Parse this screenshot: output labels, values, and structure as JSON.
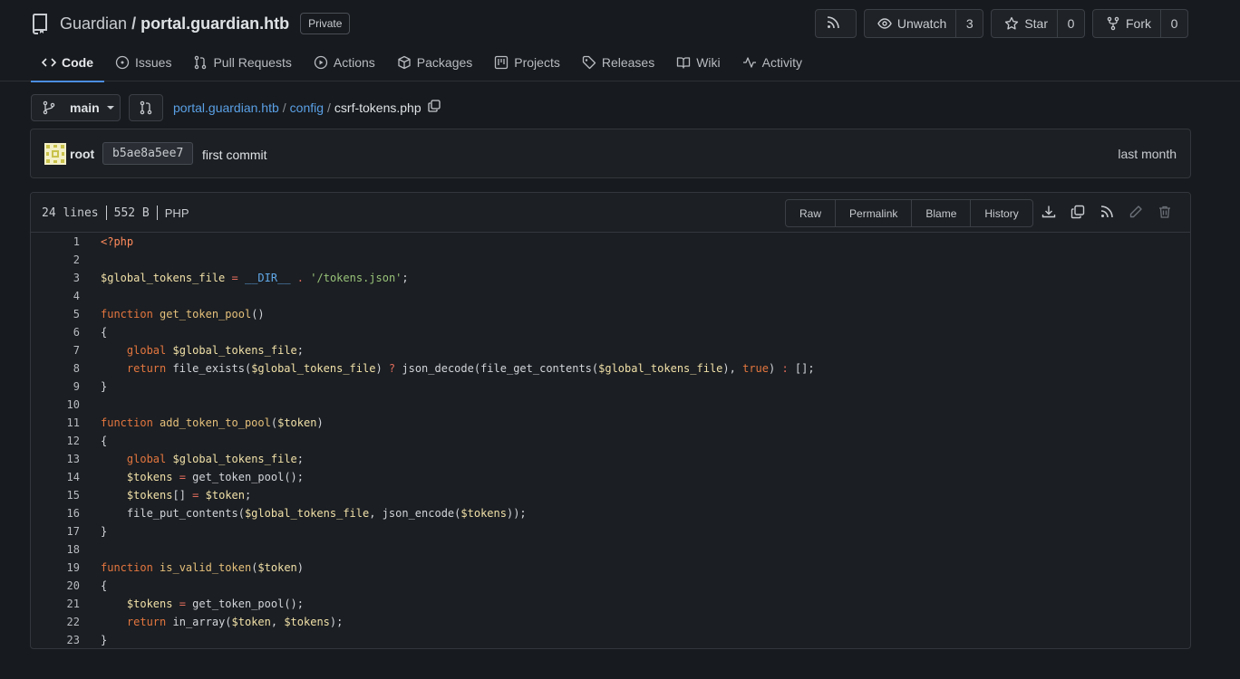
{
  "repo": {
    "owner": "Guardian",
    "separator": "/",
    "name": "portal.guardian.htb",
    "visibility": "Private"
  },
  "header_buttons": {
    "unwatch_label": "Unwatch",
    "unwatch_count": "3",
    "star_label": "Star",
    "star_count": "0",
    "fork_label": "Fork",
    "fork_count": "0"
  },
  "tabs": [
    {
      "label": "Code",
      "icon": "code-icon",
      "active": true
    },
    {
      "label": "Issues",
      "icon": "issue-icon"
    },
    {
      "label": "Pull Requests",
      "icon": "pull-request-icon"
    },
    {
      "label": "Actions",
      "icon": "play-icon"
    },
    {
      "label": "Packages",
      "icon": "package-icon"
    },
    {
      "label": "Projects",
      "icon": "project-icon"
    },
    {
      "label": "Releases",
      "icon": "tag-icon"
    },
    {
      "label": "Wiki",
      "icon": "book-icon"
    },
    {
      "label": "Activity",
      "icon": "pulse-icon"
    }
  ],
  "branch": "main",
  "breadcrumb": {
    "root": "portal.guardian.htb",
    "sep1": "/",
    "dir": "config",
    "sep2": "/",
    "file": "csrf-tokens.php"
  },
  "commit": {
    "author": "root",
    "sha": "b5ae8a5ee7",
    "message": "first commit",
    "time": "last month"
  },
  "file": {
    "lines": "24 lines",
    "size": "552 B",
    "language": "PHP",
    "actions": [
      "Raw",
      "Permalink",
      "Blame",
      "History"
    ],
    "icons": [
      "download-icon",
      "copy-icon",
      "rss-icon",
      "edit-icon",
      "delete-icon"
    ]
  },
  "colors": {
    "background": "#171a1e",
    "accent": "#4c8ee0",
    "link": "#5aa0e6"
  },
  "code_lines": [
    [
      [
        "t",
        "<?php"
      ]
    ],
    [],
    [
      [
        "v",
        "$global_tokens_file"
      ],
      [
        "p",
        " "
      ],
      [
        "op",
        "="
      ],
      [
        "p",
        " "
      ],
      [
        "c",
        "__DIR__"
      ],
      [
        "p",
        " "
      ],
      [
        "op",
        "."
      ],
      [
        "p",
        " "
      ],
      [
        "s",
        "'/tokens.json'"
      ],
      [
        "p",
        ";"
      ]
    ],
    [],
    [
      [
        "kw",
        "function"
      ],
      [
        "p",
        " "
      ],
      [
        "f",
        "get_token_pool"
      ],
      [
        "p",
        "()"
      ]
    ],
    [
      [
        "p",
        "{"
      ]
    ],
    [
      [
        "p",
        "    "
      ],
      [
        "kw",
        "global"
      ],
      [
        "p",
        " "
      ],
      [
        "v",
        "$global_tokens_file"
      ],
      [
        "p",
        ";"
      ]
    ],
    [
      [
        "p",
        "    "
      ],
      [
        "kw",
        "return"
      ],
      [
        "p",
        " file_exists("
      ],
      [
        "v",
        "$global_tokens_file"
      ],
      [
        "p",
        ") "
      ],
      [
        "op",
        "?"
      ],
      [
        "p",
        " json_decode(file_get_contents("
      ],
      [
        "v",
        "$global_tokens_file"
      ],
      [
        "p",
        "), "
      ],
      [
        "kw",
        "true"
      ],
      [
        "p",
        ") "
      ],
      [
        "op",
        ":"
      ],
      [
        "p",
        " [];"
      ]
    ],
    [
      [
        "p",
        "}"
      ]
    ],
    [],
    [
      [
        "kw",
        "function"
      ],
      [
        "p",
        " "
      ],
      [
        "f",
        "add_token_to_pool"
      ],
      [
        "p",
        "("
      ],
      [
        "v",
        "$token"
      ],
      [
        "p",
        ")"
      ]
    ],
    [
      [
        "p",
        "{"
      ]
    ],
    [
      [
        "p",
        "    "
      ],
      [
        "kw",
        "global"
      ],
      [
        "p",
        " "
      ],
      [
        "v",
        "$global_tokens_file"
      ],
      [
        "p",
        ";"
      ]
    ],
    [
      [
        "p",
        "    "
      ],
      [
        "v",
        "$tokens"
      ],
      [
        "p",
        " "
      ],
      [
        "op",
        "="
      ],
      [
        "p",
        " get_token_pool();"
      ]
    ],
    [
      [
        "p",
        "    "
      ],
      [
        "v",
        "$tokens"
      ],
      [
        "p",
        "[] "
      ],
      [
        "op",
        "="
      ],
      [
        "p",
        " "
      ],
      [
        "v",
        "$token"
      ],
      [
        "p",
        ";"
      ]
    ],
    [
      [
        "p",
        "    file_put_contents("
      ],
      [
        "v",
        "$global_tokens_file"
      ],
      [
        "p",
        ", json_encode("
      ],
      [
        "v",
        "$tokens"
      ],
      [
        "p",
        "));"
      ]
    ],
    [
      [
        "p",
        "}"
      ]
    ],
    [],
    [
      [
        "kw",
        "function"
      ],
      [
        "p",
        " "
      ],
      [
        "f",
        "is_valid_token"
      ],
      [
        "p",
        "("
      ],
      [
        "v",
        "$token"
      ],
      [
        "p",
        ")"
      ]
    ],
    [
      [
        "p",
        "{"
      ]
    ],
    [
      [
        "p",
        "    "
      ],
      [
        "v",
        "$tokens"
      ],
      [
        "p",
        " "
      ],
      [
        "op",
        "="
      ],
      [
        "p",
        " get_token_pool();"
      ]
    ],
    [
      [
        "p",
        "    "
      ],
      [
        "kw",
        "return"
      ],
      [
        "p",
        " in_array("
      ],
      [
        "v",
        "$token"
      ],
      [
        "p",
        ", "
      ],
      [
        "v",
        "$tokens"
      ],
      [
        "p",
        ");"
      ]
    ],
    [
      [
        "p",
        "}"
      ]
    ]
  ]
}
